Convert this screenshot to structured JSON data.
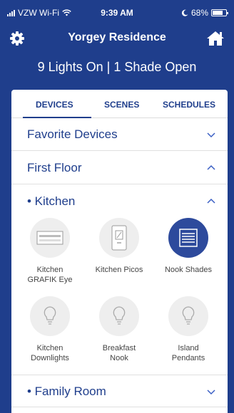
{
  "status": {
    "carrier": "VZW Wi-Fi",
    "time": "9:39 AM",
    "battery": "68%"
  },
  "header": {
    "title": "Yorgey Residence"
  },
  "summary": "9 Lights On | 1 Shade Open",
  "tabs": [
    "DEVICES",
    "SCENES",
    "SCHEDULES"
  ],
  "sections": {
    "favorites": "Favorite Devices",
    "first_floor": "First Floor",
    "kitchen": "• Kitchen",
    "family_room": "• Family Room"
  },
  "devices": [
    {
      "label": "Kitchen\nGRAFIK Eye",
      "icon": "grafik-eye-icon"
    },
    {
      "label": "Kitchen Picos",
      "icon": "pico-remote-icon"
    },
    {
      "label": "Nook Shades",
      "icon": "shade-icon",
      "active": true
    },
    {
      "label": "Kitchen\nDownlights",
      "icon": "light-bulb-icon"
    },
    {
      "label": "Breakfast\nNook",
      "icon": "light-bulb-icon"
    },
    {
      "label": "Island\nPendants",
      "icon": "light-bulb-icon"
    }
  ],
  "colors": {
    "brand": "#1f3e8c",
    "active": "#2d4a9c"
  }
}
